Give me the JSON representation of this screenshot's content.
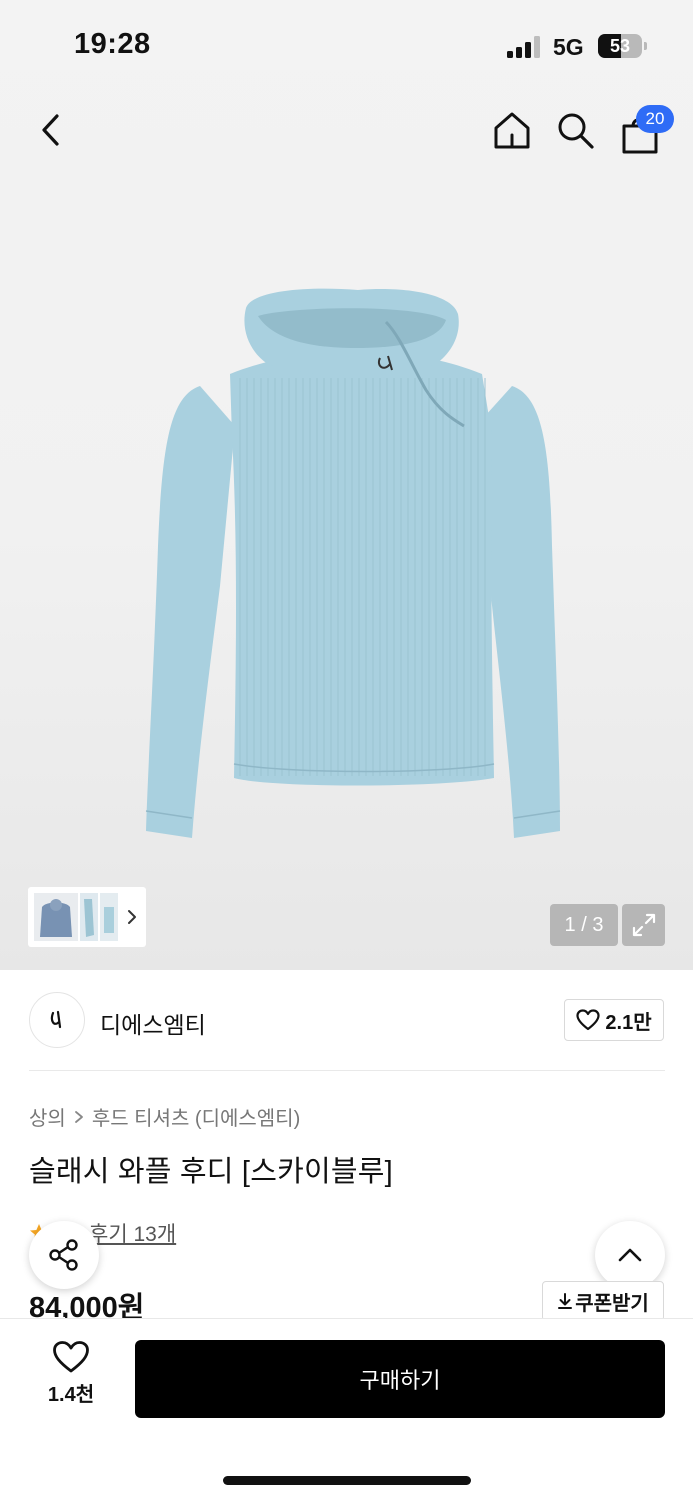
{
  "status_bar": {
    "time": "19:28",
    "network": "5G",
    "battery": "53",
    "battery_level": 0.53
  },
  "header": {
    "cart_count": "20"
  },
  "gallery": {
    "page_counter": "1 / 3",
    "product_color": "#a9d0df",
    "product_shade": "#93bccb"
  },
  "brand": {
    "name": "디에스엠티",
    "likes": "2.1만"
  },
  "breadcrumb": {
    "category": "상의",
    "subcategory": "후드 티셔츠 (디에스엠티)"
  },
  "product": {
    "title": "슬래시 와플 후디 [스카이블루]",
    "review_link": "후기 13개",
    "price": "84,000원"
  },
  "coupon": {
    "label": "쿠폰받기"
  },
  "bottom_bar": {
    "wish_count": "1.4천",
    "buy_label": "구매하기"
  },
  "colors": {
    "accent": "#2f6cf6",
    "star": "#f5a623",
    "buy_button": "#000000"
  }
}
